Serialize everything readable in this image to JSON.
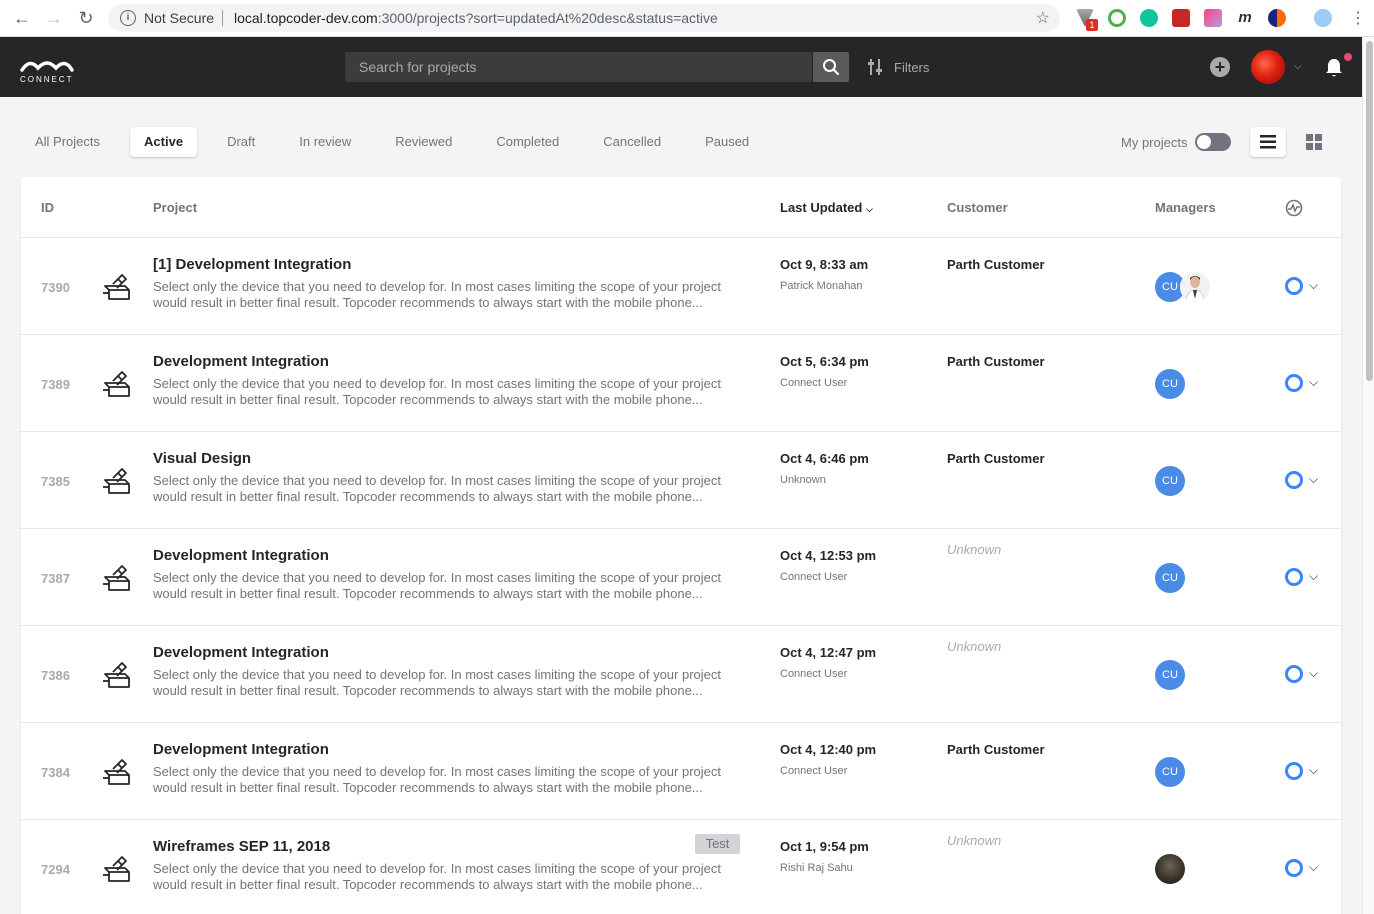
{
  "browser": {
    "security_label": "Not Secure",
    "url_host": "local.topcoder-dev.com",
    "url_rest": ":3000/projects?sort=updatedAt%20desc&status=active",
    "ext_badge": "1"
  },
  "header": {
    "logo_text": "CONNECT",
    "search_placeholder": "Search for projects",
    "filters_label": "Filters"
  },
  "tabs": [
    {
      "label": "All Projects",
      "active": false
    },
    {
      "label": "Active",
      "active": true
    },
    {
      "label": "Draft",
      "active": false
    },
    {
      "label": "In review",
      "active": false
    },
    {
      "label": "Reviewed",
      "active": false
    },
    {
      "label": "Completed",
      "active": false
    },
    {
      "label": "Cancelled",
      "active": false
    },
    {
      "label": "Paused",
      "active": false
    }
  ],
  "toolbar": {
    "my_projects_label": "My projects",
    "my_projects_on": false
  },
  "table": {
    "columns": {
      "id": "ID",
      "project": "Project",
      "last_updated": "Last Updated",
      "customer": "Customer",
      "managers": "Managers"
    },
    "rows": [
      {
        "id": "7390",
        "title": "[1] Development Integration",
        "desc": "Select only the device that you need to develop for. In most cases limiting the scope of your project would result in better final result. Topcoder recommends to always start with the mobile phone...",
        "tag": "",
        "date": "Oct 9, 8:33 am",
        "user": "Patrick Monahan",
        "customer": "Parth Customer",
        "manager_initials": "CU",
        "extra_manager": true,
        "photo_manager": false
      },
      {
        "id": "7389",
        "title": "Development Integration",
        "desc": "Select only the device that you need to develop for. In most cases limiting the scope of your project would result in better final result. Topcoder recommends to always start with the mobile phone...",
        "tag": "",
        "date": "Oct 5, 6:34 pm",
        "user": "Connect User",
        "customer": "Parth Customer",
        "manager_initials": "CU",
        "extra_manager": false,
        "photo_manager": false
      },
      {
        "id": "7385",
        "title": "Visual Design",
        "desc": "Select only the device that you need to develop for. In most cases limiting the scope of your project would result in better final result. Topcoder recommends to always start with the mobile phone...",
        "tag": "",
        "date": "Oct 4, 6:46 pm",
        "user": "Unknown",
        "customer": "Parth Customer",
        "manager_initials": "CU",
        "extra_manager": false,
        "photo_manager": false
      },
      {
        "id": "7387",
        "title": "Development Integration",
        "desc": "Select only the device that you need to develop for. In most cases limiting the scope of your project would result in better final result. Topcoder recommends to always start with the mobile phone...",
        "tag": "",
        "date": "Oct 4, 12:53 pm",
        "user": "Connect User",
        "customer": "Unknown",
        "manager_initials": "CU",
        "extra_manager": false,
        "photo_manager": false
      },
      {
        "id": "7386",
        "title": "Development Integration",
        "desc": "Select only the device that you need to develop for. In most cases limiting the scope of your project would result in better final result. Topcoder recommends to always start with the mobile phone...",
        "tag": "",
        "date": "Oct 4, 12:47 pm",
        "user": "Connect User",
        "customer": "Unknown",
        "manager_initials": "CU",
        "extra_manager": false,
        "photo_manager": false
      },
      {
        "id": "7384",
        "title": "Development Integration",
        "desc": "Select only the device that you need to develop for. In most cases limiting the scope of your project would result in better final result. Topcoder recommends to always start with the mobile phone...",
        "tag": "",
        "date": "Oct 4, 12:40 pm",
        "user": "Connect User",
        "customer": "Parth Customer",
        "manager_initials": "CU",
        "extra_manager": false,
        "photo_manager": false
      },
      {
        "id": "7294",
        "title": "Wireframes SEP 11, 2018",
        "desc": "Select only the device that you need to develop for. In most cases limiting the scope of your project would result in better final result. Topcoder recommends to always start with the mobile phone...",
        "tag": "Test",
        "date": "Oct 1, 9:54 pm",
        "user": "Rishi Raj Sahu",
        "customer": "Unknown",
        "manager_initials": "",
        "extra_manager": false,
        "photo_manager": true
      }
    ]
  },
  "colors": {
    "header_bg": "#262628",
    "accent_blue": "#3a86ff",
    "manager_avatar": "#4a8be6",
    "notification_dot": "#ef476f"
  }
}
